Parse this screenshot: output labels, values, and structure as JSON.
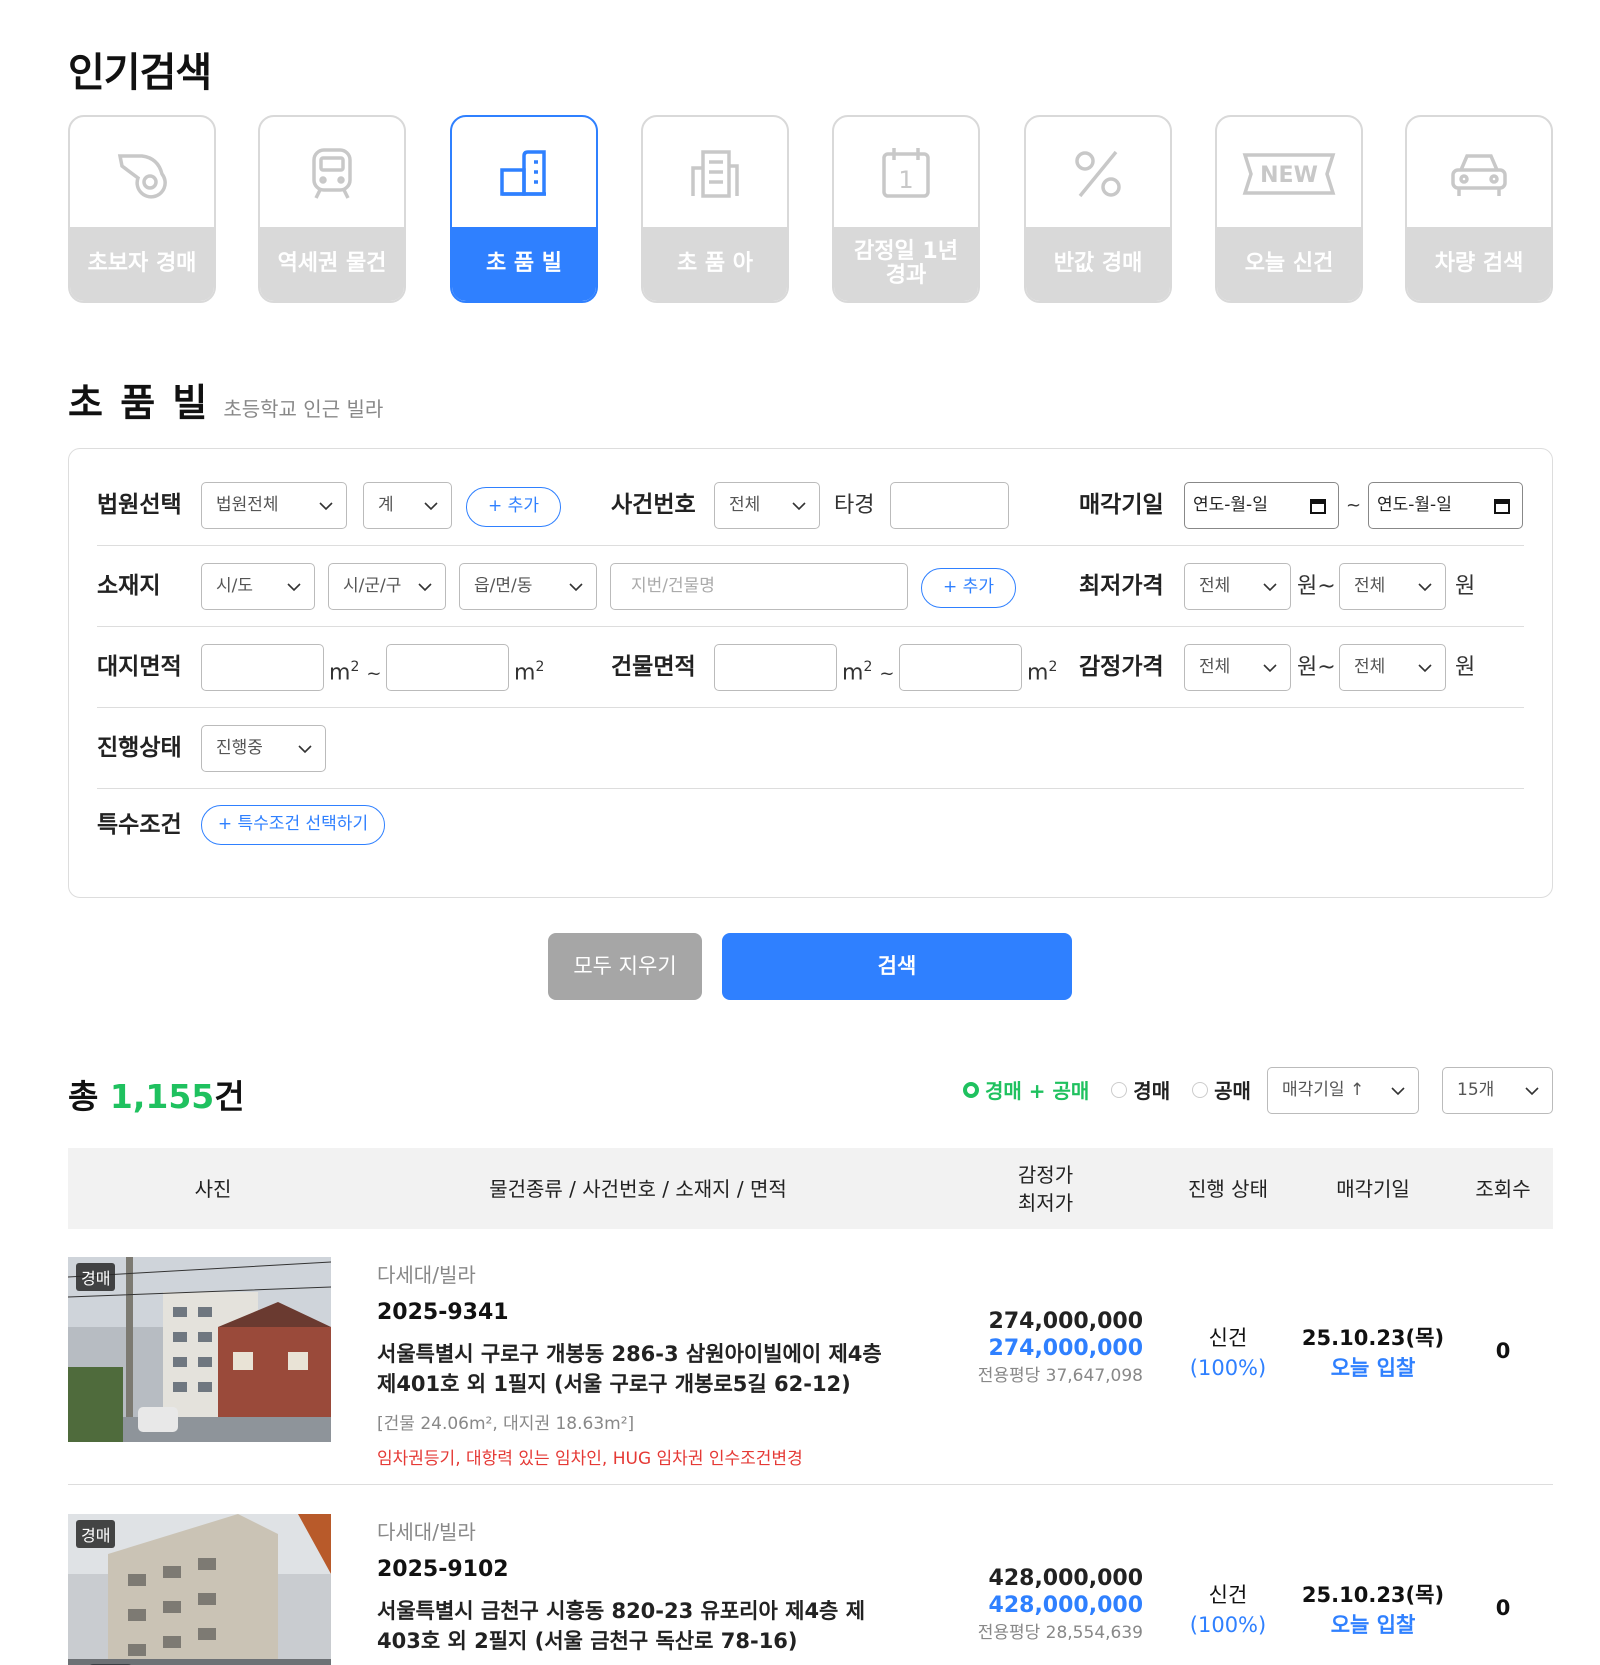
{
  "popular": {
    "title": "인기검색",
    "categories": [
      {
        "label": "초보자 경매",
        "icon": "whistle-icon"
      },
      {
        "label": "역세권 물건",
        "icon": "train-icon"
      },
      {
        "label": "초 품 빌",
        "icon": "school-building-icon"
      },
      {
        "label": "초 품 아",
        "icon": "apartment-icon"
      },
      {
        "label": "감정일 1년 경과",
        "icon": "calendar-icon"
      },
      {
        "label": "반값 경매",
        "icon": "percent-icon"
      },
      {
        "label": "오늘 신건",
        "icon": "new-ticket-icon"
      },
      {
        "label": "차량 검색",
        "icon": "car-icon"
      }
    ],
    "active_index": 2
  },
  "section": {
    "title": "초 품 빌",
    "subtitle": "초등학교 인근 빌라"
  },
  "filter": {
    "court_label": "법원선택",
    "court_value": "법원전체",
    "court_sub_value": "계",
    "add_label": "+ 추가",
    "case_label": "사건번호",
    "case_value": "전체",
    "case_prefix": "타경",
    "sale_date_label": "매각기일",
    "date_placeholder": "연도-월-일",
    "tilde": "~",
    "location_label": "소재지",
    "sido": "시/도",
    "sigungu": "시/군/구",
    "eupmyeondong": "읍/면/동",
    "address_placeholder": "지번/건물명",
    "min_price_label": "최저가격",
    "appraisal_label": "감정가격",
    "all": "전체",
    "won_tilde": "원~",
    "won": "원",
    "land_area_label": "대지면적",
    "building_area_label": "건물면적",
    "m2_unit": "m",
    "m2_sup": "2",
    "status_label": "진행상태",
    "status_value": "진행중",
    "special_label": "특수조건",
    "special_button": "+ 특수조건 선택하기"
  },
  "actions": {
    "clear": "모두 지우기",
    "search": "검색"
  },
  "results": {
    "total_prefix": "총 ",
    "total_count": "1,155",
    "total_suffix": "건",
    "radio_options": [
      "경매 + 공매",
      "경매",
      "공매"
    ],
    "radio_selected": 0,
    "sort_value": "매각기일 ↑",
    "page_size": "15개"
  },
  "table": {
    "headers": [
      "사진",
      "물건종류 / 사건번호 / 소재지 / 면적",
      "감정가\n최저가",
      "진행 상태",
      "매각기일",
      "조회수"
    ],
    "rows": [
      {
        "badge": "경매",
        "kind": "다세대/빌라",
        "case": "2025-9341",
        "address": "서울특별시 구로구 개봉동 286-3 삼원아이빌에이 제4층 제401호 외 1필지 (서울 구로구 개봉로5길 62-12)",
        "area": "[건물 24.06m², 대지권 18.63m²]",
        "warning": "임차권등기, 대항력 있는 임차인, HUG 임차권 인수조건변경",
        "appraisal": "274,000,000",
        "min_price": "274,000,000",
        "per_pyeong": "전용평당 37,647,098",
        "status": "신건",
        "status_ratio": "(100%)",
        "sale_date": "25.10.23(목)",
        "sale_note": "오늘 입찰",
        "views": "0"
      },
      {
        "badge": "경매",
        "kind": "다세대/빌라",
        "case": "2025-9102",
        "address": "서울특별시 금천구 시흥동 820-23 유포리아 제4층 제403호 외 2필지 (서울 금천구 독산로 78-16)",
        "area": "",
        "warning": "",
        "appraisal": "428,000,000",
        "min_price": "428,000,000",
        "per_pyeong": "전용평당 28,554,639",
        "status": "신건",
        "status_ratio": "(100%)",
        "sale_date": "25.10.23(목)",
        "sale_note": "오늘 입찰",
        "views": "0"
      }
    ]
  },
  "colors": {
    "accent": "#2f80ff",
    "green": "#1fc15f",
    "red": "#e53935",
    "gray": "#d9d9d9"
  }
}
